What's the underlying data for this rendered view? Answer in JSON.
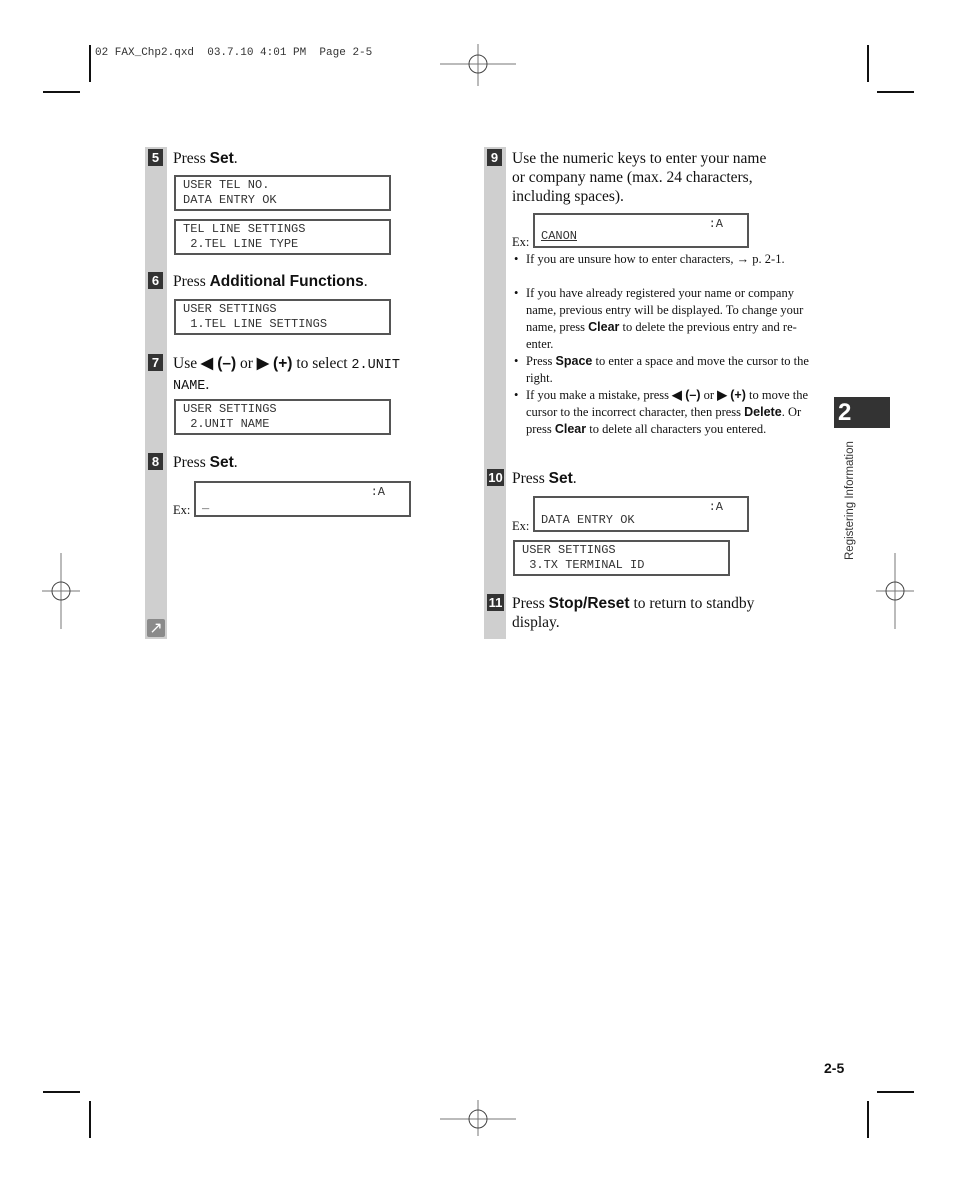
{
  "slug": "02 FAX_Chp2.qxd  03.7.10 4:01 PM  Page 2-5",
  "chapter_tab": {
    "number": "2",
    "label": "Registering Information"
  },
  "page_number": "2-5",
  "ex_label": "Ex:",
  "steps": {
    "s5": {
      "num": "5",
      "pre": "Press ",
      "key": "Set",
      "post": ".",
      "lcd1": [
        "USER TEL NO.",
        "DATA ENTRY OK"
      ],
      "lcd2": [
        "TEL LINE SETTINGS",
        " 2.TEL LINE TYPE"
      ]
    },
    "s6": {
      "num": "6",
      "pre": "Press ",
      "key": "Additional Functions",
      "post": ".",
      "lcd1": [
        "USER SETTINGS",
        " 1.TEL LINE SETTINGS"
      ]
    },
    "s7": {
      "num": "7",
      "pre": "Use ",
      "left_key": "◀ (–)",
      "mid": " or ",
      "right_key": "▶ (+)",
      "post": " to select ",
      "code1": "2.UNIT",
      "code2": "NAME",
      "end": ".",
      "lcd1": [
        "USER SETTINGS",
        " 2.UNIT NAME"
      ]
    },
    "s8": {
      "num": "8",
      "pre": "Press ",
      "key": "Set",
      "post": ".",
      "lcd_right": ":A",
      "lcd_line2": "_"
    },
    "s9": {
      "num": "9",
      "lines": [
        "Use the numeric keys to enter your name",
        "or company name (max. 24 characters,",
        "including spaces)."
      ],
      "lcd_right": ":A",
      "lcd_line2": "CANON",
      "bullets": [
        {
          "text": "If you are unsure how to enter characters, → p. 2-1."
        },
        {
          "pre": "If you have already registered your name or company name, previous entry will be displayed. To change your name, press ",
          "key": "Clear",
          "post": " to delete the previous entry and re-enter."
        },
        {
          "pre": "Press ",
          "key": "Space",
          "post": " to enter a space and move the cursor to the right."
        },
        {
          "pre": "If you make a mistake, press ",
          "k1": "◀ (–)",
          "mid": " or ",
          "k2": "▶ (+)",
          "mid2": " to move the cursor to the incorrect character, then press ",
          "k3": "Delete",
          "mid3": ". Or press ",
          "k4": "Clear",
          "post": " to delete all characters you entered."
        }
      ]
    },
    "s10": {
      "num": "10",
      "pre": "Press ",
      "key": "Set",
      "post": ".",
      "lcd_right": ":A",
      "lcd_line2": "DATA ENTRY OK",
      "lcd2": [
        "USER SETTINGS",
        " 3.TX TERMINAL ID"
      ]
    },
    "s11": {
      "num": "11",
      "pre": "Press ",
      "key": "Stop/Reset",
      "post": " to return to standby",
      "line2": "display."
    }
  },
  "continue_icon": "↗"
}
